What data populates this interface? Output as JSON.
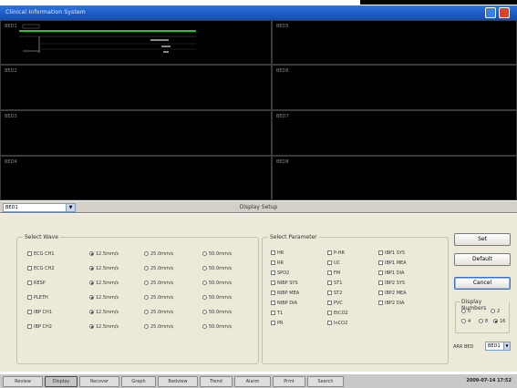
{
  "window": {
    "title": "Clinical Information System"
  },
  "monitor_beds": [
    {
      "label": "BED1"
    },
    {
      "label": "BED2"
    },
    {
      "label": "BED3"
    },
    {
      "label": "BED4"
    },
    {
      "label": "BED5"
    },
    {
      "label": "BED6"
    },
    {
      "label": "BED7"
    },
    {
      "label": "BED8"
    }
  ],
  "control_bar": {
    "bed_select_value": "BED1",
    "panel_title": "Display Setup"
  },
  "select_wave": {
    "label": "Select Wave",
    "rows": [
      {
        "name": "ECG CH1",
        "speeds": [
          "12.5mm/s",
          "25.0mm/s",
          "50.0mm/s"
        ],
        "selected": 0
      },
      {
        "name": "ECG CH2",
        "speeds": [
          "12.5mm/s",
          "25.0mm/s",
          "50.0mm/s"
        ],
        "selected": 0
      },
      {
        "name": "RESP",
        "speeds": [
          "12.5mm/s",
          "25.0mm/s",
          "50.0mm/s"
        ],
        "selected": 0
      },
      {
        "name": "PLETH",
        "speeds": [
          "12.5mm/s",
          "25.0mm/s",
          "50.0mm/s"
        ],
        "selected": 0
      },
      {
        "name": "IBP CH1",
        "speeds": [
          "12.5mm/s",
          "25.0mm/s",
          "50.0mm/s"
        ],
        "selected": 0
      },
      {
        "name": "IBP CH2",
        "speeds": [
          "12.5mm/s",
          "25.0mm/s",
          "50.0mm/s"
        ],
        "selected": 0
      }
    ]
  },
  "select_parameter": {
    "label": "Select Parameter",
    "columns": [
      [
        "HR",
        "RR",
        "SPO2",
        "NIBP SYS",
        "NIBP MEA",
        "NIBP DIA",
        "T1",
        "PR"
      ],
      [
        "P-HR",
        "UC",
        "FM",
        "ST1",
        "ST2",
        "PVC",
        "EtCO2",
        "InCO2"
      ],
      [
        "IBP1 SYS",
        "IBP1 MEA",
        "IBP1 DIA",
        "IBP2 SYS",
        "IBP2 MEA",
        "IBP2 DIA"
      ]
    ]
  },
  "buttons": {
    "set": "Set",
    "default": "Default",
    "cancel": "Cancel"
  },
  "display_numbers": {
    "label": "Display Numbers",
    "options": [
      "0",
      "2",
      "4",
      "8",
      "16"
    ],
    "selected": "16"
  },
  "arr_bed": {
    "label": "ARR BED",
    "value": "BED1"
  },
  "taskbar": {
    "tabs": [
      "Review",
      "Display",
      "Recover",
      "Graph",
      "Bedview",
      "Trend",
      "Alarm",
      "Print",
      "Search"
    ],
    "active_index": 1,
    "clock": "2009-07-14 17:52"
  },
  "colors": {
    "titlebar": "#1d5cc6",
    "wave_green": "#22c81e",
    "monitor_bg": "#000000",
    "panel_bg": "#ece9d8"
  }
}
